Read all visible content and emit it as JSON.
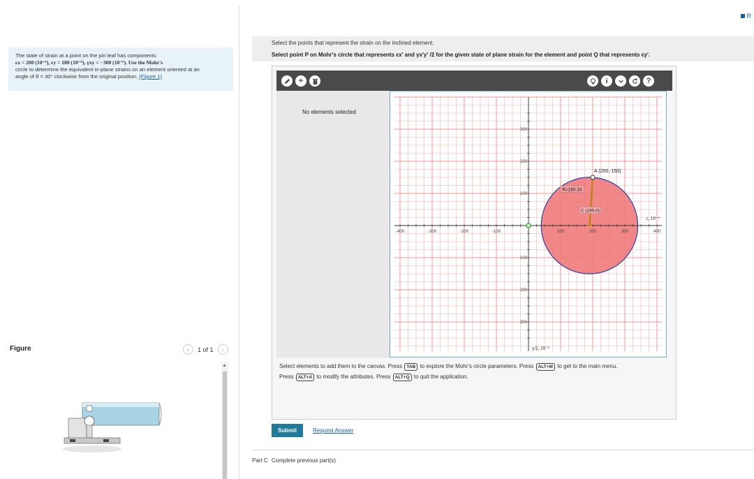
{
  "problem": {
    "line1": "The state of strain at a point on the pin leaf has components",
    "line2": "ϵx = 200 (10⁻⁶), ϵy = 180 (10⁻⁶), γxy = −300 (10⁻⁶). Use the Mohr's",
    "line3": "circle to determine the equivalent in-plane strains on an element oriented at an",
    "line4": "angle of θ = 30° clockwise from the original position.",
    "figure_link": "(Figure 1)"
  },
  "figure": {
    "label": "Figure",
    "pager": "1 of 1",
    "prev_icon": "chevron-left-icon",
    "next_icon": "chevron-right-icon"
  },
  "top_link": "R",
  "instructions": {
    "line1": "Select the points that represent the strain on the inclined element.",
    "line2": "Select point P on Mohr's circle that represents ϵx′ and γx′y′ /2 for the given state of plane strain for the element and point Q that represents ϵy′."
  },
  "toolbar": {
    "left_icons": [
      "pencil-icon",
      "plus-icon",
      "trash-icon"
    ],
    "right_icons": [
      "hint-icon",
      "info-icon",
      "chevron-down-icon",
      "reset-icon",
      "help-icon"
    ]
  },
  "side_panel": {
    "status": "No elements selected"
  },
  "plot": {
    "x_axis_label": "ε, 10⁻⁶",
    "y_axis_label": "γ/2, 10⁻⁶",
    "x_ticks": [
      "-400",
      "-300",
      "-200",
      "-100",
      "100",
      "200",
      "300",
      "400"
    ],
    "y_ticks_up": [
      "300",
      "200",
      "100"
    ],
    "y_ticks_down": [
      "100",
      "200",
      "300"
    ],
    "point_a_label": "A (200,-150)",
    "radius_label": "R=150.33",
    "center_label": "C (190,0)",
    "circle_fill": "#f07a7a",
    "circle_stroke": "#2a3fb0",
    "grid_color": "#f28a8a",
    "origin_color": "#22bb22"
  },
  "chart_data": {
    "type": "scatter",
    "title": "",
    "xlabel": "ε, 10⁻⁶",
    "ylabel": "γ/2, 10⁻⁶",
    "xlim": [
      -400,
      400
    ],
    "ylim": [
      -400,
      400
    ],
    "y_axis_inverted": true,
    "grid": true,
    "series": [
      {
        "name": "A (200,-150)",
        "x": [
          200
        ],
        "y": [
          -150
        ]
      },
      {
        "name": "C (190,0)",
        "x": [
          190
        ],
        "y": [
          0
        ]
      }
    ],
    "circle": {
      "center": [
        190,
        0
      ],
      "radius": 150.33
    }
  },
  "footer": {
    "t1": "Select elements to add them to the canvas. Press",
    "k1": "TAB",
    "t2": "to explore the Mohr's circle parameters. Press",
    "k2": "ALT+M",
    "t3": "to get to the main menu.",
    "t4": "Press",
    "k3": "ALT+A",
    "t5": "to modify the attributes. Press",
    "k4": "ALT+Q",
    "t6": "to quit the application."
  },
  "actions": {
    "submit": "Submit",
    "request": "Request Answer"
  },
  "part_c": {
    "label": "Part C",
    "text": "Complete previous part(s)"
  }
}
